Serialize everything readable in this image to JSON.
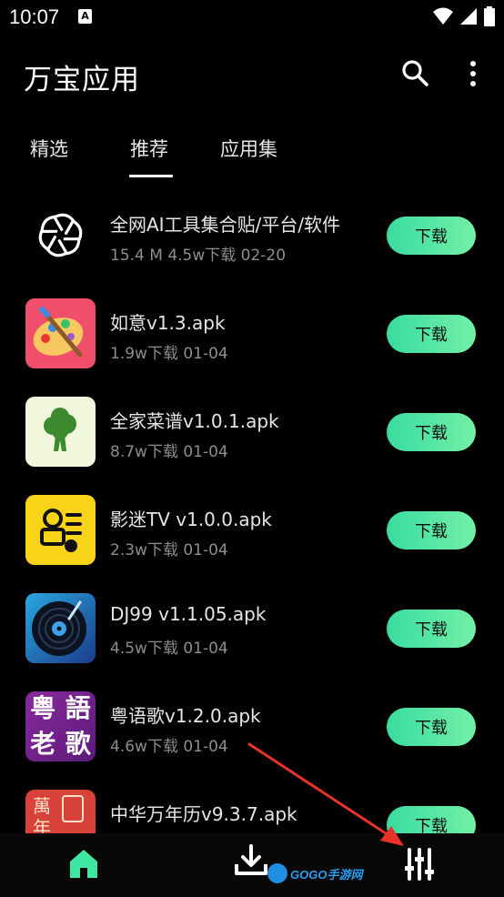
{
  "status_bar": {
    "time": "10:07",
    "notification_badge": "A"
  },
  "app_bar": {
    "title": "万宝应用",
    "search_icon": "search-icon",
    "menu_icon": "more-vertical-icon"
  },
  "tabs": [
    {
      "label": "精选",
      "selected": false
    },
    {
      "label": "推荐",
      "selected": true
    },
    {
      "label": "应用集",
      "selected": false
    }
  ],
  "apps": [
    {
      "name": "全网AI工具集合贴/平台/软件",
      "meta": "15.4 M  4.5w下载  02-20",
      "button": "下载",
      "icon": "openai-logo-icon"
    },
    {
      "name": "如意v1.3.apk",
      "meta": " 1.9w下载  01-04",
      "button": "下载",
      "icon": "paint-palette-icon"
    },
    {
      "name": "全家菜谱v1.0.1.apk",
      "meta": " 8.7w下载  01-04",
      "button": "下载",
      "icon": "broccoli-icon"
    },
    {
      "name": "影迷TV v1.0.0.apk",
      "meta": " 2.3w下载  01-04",
      "button": "下载",
      "icon": "yingmi-tv-logo-icon"
    },
    {
      "name": "DJ99 v1.1.05.apk",
      "meta": " 4.5w下载  01-04",
      "button": "下载",
      "icon": "vinyl-record-icon"
    },
    {
      "name": "粤语歌v1.2.0.apk",
      "meta": " 4.6w下载  01-04",
      "button": "下载",
      "icon": "cantonese-songs-logo-icon",
      "icon_text": [
        "粤",
        "語",
        "老",
        "歌"
      ]
    },
    {
      "name": "中华万年历v9.3.7.apk",
      "meta": "",
      "button": "下载",
      "icon": "chinese-calendar-icon",
      "icon_text": "萬年"
    }
  ],
  "bottom_nav": {
    "items": [
      {
        "name": "home",
        "icon": "home-icon",
        "active": true
      },
      {
        "name": "downloads",
        "icon": "download-icon",
        "active": false
      },
      {
        "name": "manage",
        "icon": "sliders-icon",
        "active": false
      }
    ],
    "watermark": "GOGO手游网"
  },
  "colors": {
    "accent_green": "#3ee6a2",
    "background": "#000000",
    "annotation_arrow": "#e8322a"
  }
}
